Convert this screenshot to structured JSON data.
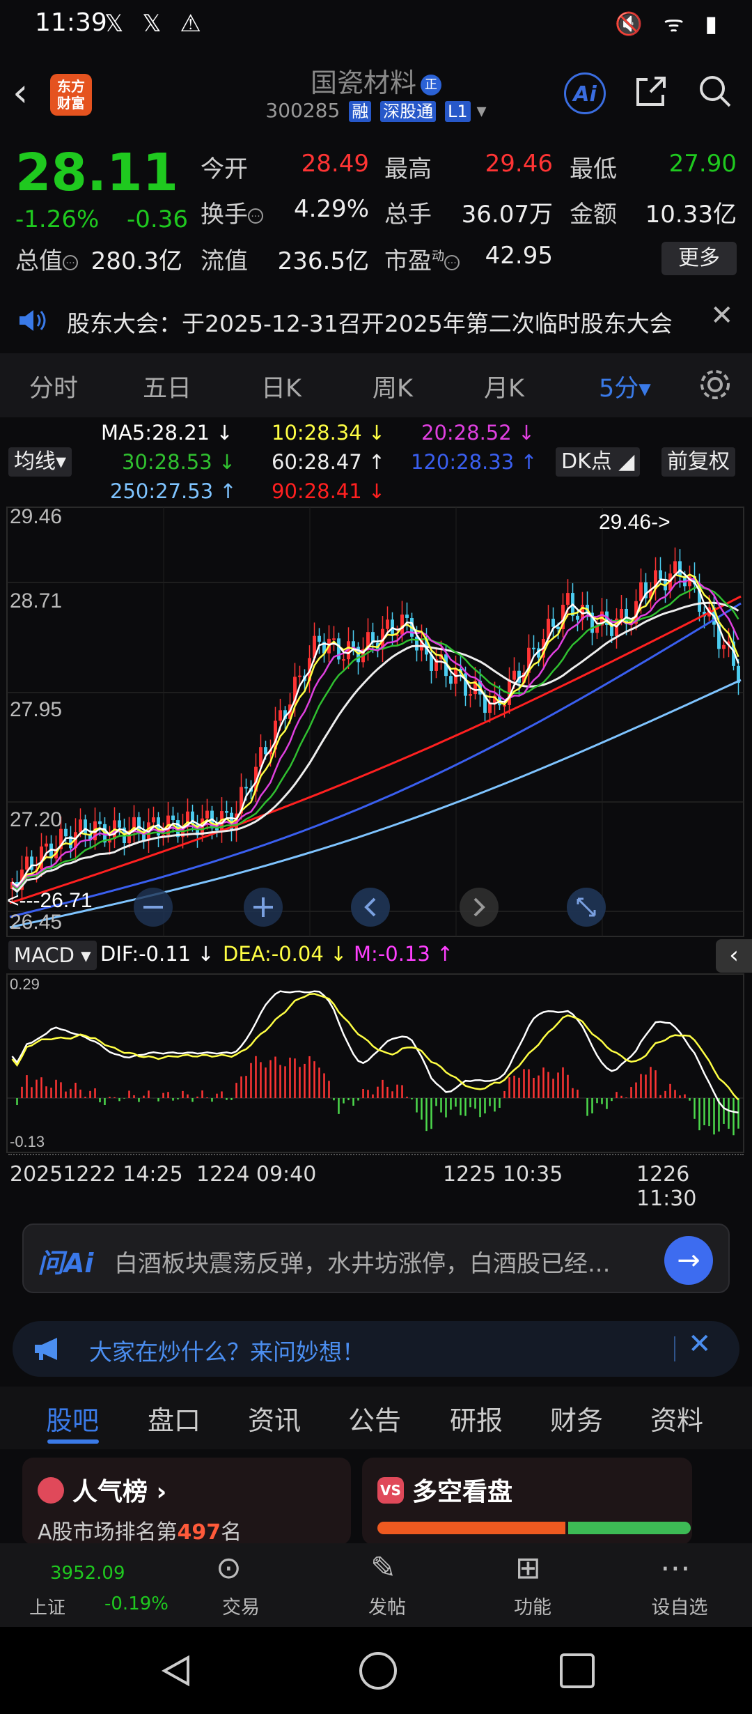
{
  "status": {
    "time": "11:39",
    "left_icons": "𝕏 𝕏 ⚠",
    "right_icons": "🔇 ᯤ ▮"
  },
  "header": {
    "logo_line1": "东方",
    "logo_line2": "财富",
    "stock_name": "国瓷材料",
    "qi_badge": "正",
    "code": "300285",
    "tag_rong": "融",
    "tag_sgt": "深股通",
    "tag_l1": "L1",
    "ai_label": "Ai"
  },
  "quote": {
    "price": "28.11",
    "pct": "-1.26%",
    "chg": "-0.36",
    "open_label": "今开",
    "open": "28.49",
    "high_label": "最高",
    "high": "29.46",
    "low_label": "最低",
    "low": "27.90",
    "turnover_label": "换手",
    "turnover": "4.29%",
    "volume_label": "总手",
    "volume": "36.07万",
    "amount_label": "金额",
    "amount": "10.33亿",
    "mcap_label": "总值",
    "mcap": "280.3亿",
    "float_label": "流值",
    "float": "236.5亿",
    "pe_label": "市盈",
    "pe_sup": "动",
    "pe": "42.95",
    "more": "更多"
  },
  "notice": {
    "text": "股东大会：于2025-12-31召开2025年第二次临时股东大会"
  },
  "ktabs": [
    "分时",
    "五日",
    "日K",
    "周K",
    "月K",
    "5分▾"
  ],
  "ma": {
    "selector": "均线▾",
    "ma5": "MA5:28.21 ↓",
    "ma10": "10:28.34 ↓",
    "ma20": "20:28.52 ↓",
    "ma30": "30:28.53 ↓",
    "ma60": "60:28.47 ↑",
    "ma120": "120:28.33 ↑",
    "ma250": "250:27.53 ↑",
    "ma90": "90:28.41 ↓",
    "dk": "DK点 ◢",
    "fq": "前复权"
  },
  "chart_data": {
    "type": "candlestick",
    "price_axis": [
      "29.46",
      "28.71",
      "27.95",
      "27.20",
      "26.45"
    ],
    "high_marker": "29.46->",
    "low_marker": "<---26.71",
    "macd": {
      "label": "MACD ▾",
      "dif": "DIF:-0.11 ↓",
      "dea": "DEA:-0.04 ↓",
      "m": "M:-0.13 ↑",
      "top": "0.29",
      "bottom": "-0.13"
    },
    "dates": [
      "20251222 14:25",
      "1224 09:40",
      "1225 10:35",
      "1226 11:30"
    ],
    "colors": {
      "up": "#ff3434",
      "down": "#4ccdf0",
      "ma5": "#ffffff",
      "ma10": "#ffff44",
      "ma20": "#e040e0",
      "ma30": "#30c030",
      "ma60": "#eeeeee",
      "ma90": "#ff2020",
      "ma120": "#3a5ff0",
      "ma250": "#7fc4ff"
    }
  },
  "askai": {
    "logo": "问Ai",
    "text": "白酒板块震荡反弹，水井坊涨停，白酒股已经..."
  },
  "hot": {
    "text": "大家在炒什么？来问妙想！"
  },
  "sectabs": [
    "股吧",
    "盘口",
    "资讯",
    "公告",
    "研报",
    "财务",
    "资料"
  ],
  "cards": {
    "popular_title": "人气榜 ›",
    "popular_sub_pre": "A股市场排名第",
    "popular_rank": "497",
    "popular_sub_post": "名",
    "ls_title": "多空看盘"
  },
  "bottomnav": {
    "index_value": "3952.09",
    "index_name": "上证",
    "index_pct": "-0.19%",
    "items": [
      "交易",
      "发帖",
      "功能",
      "设自选"
    ]
  }
}
